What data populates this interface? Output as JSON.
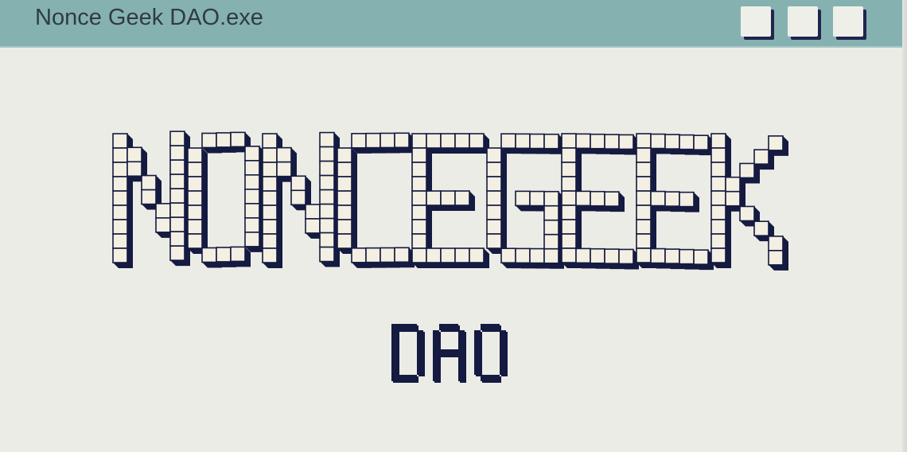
{
  "window": {
    "title": "Nonce Geek DAO.exe",
    "buttons": [
      "minimize",
      "maximize",
      "close"
    ]
  },
  "logo": {
    "wordmark": "NONCEGEEK",
    "subtitle": "DAO"
  },
  "colors": {
    "titlebar": "#85b2b0",
    "background": "#ecece6",
    "ink": "#141a40",
    "cube_face": "#f3efe2"
  }
}
